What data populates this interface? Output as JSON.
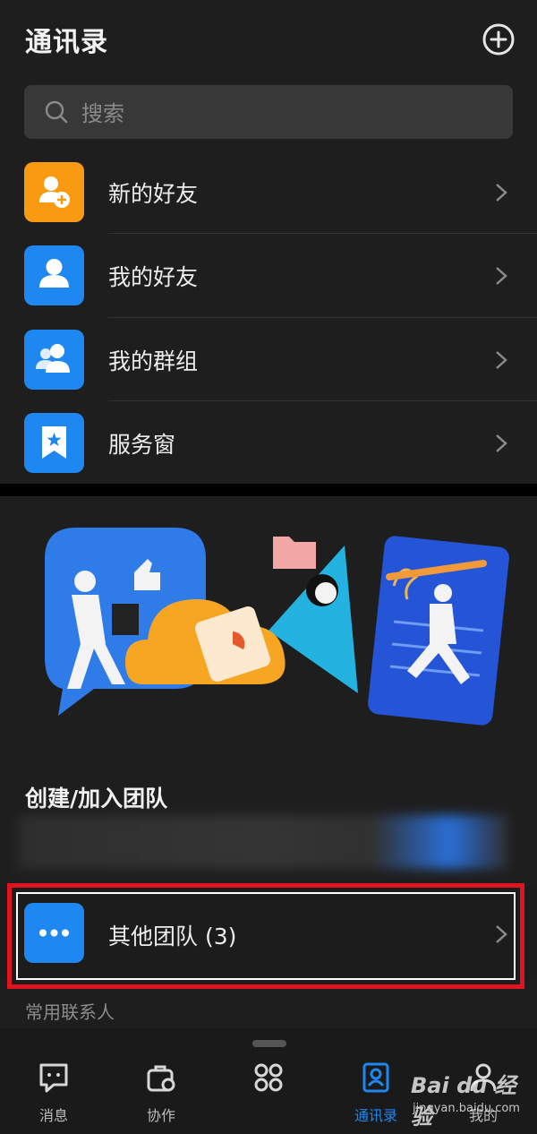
{
  "header": {
    "title": "通讯录"
  },
  "search": {
    "placeholder": "搜索"
  },
  "list": {
    "items": [
      {
        "label": "新的好友",
        "icon": "add-user-icon",
        "color": "#f99a13"
      },
      {
        "label": "我的好友",
        "icon": "user-icon",
        "color": "#1f87f0"
      },
      {
        "label": "我的群组",
        "icon": "group-icon",
        "color": "#1f87f0"
      },
      {
        "label": "服务窗",
        "icon": "bookmark-star-icon",
        "color": "#1f87f0"
      }
    ]
  },
  "team": {
    "title": "创建/加入团队",
    "other_label": "其他团队 (3)"
  },
  "contacts": {
    "label": "常用联系人"
  },
  "tabs": [
    {
      "label": "消息",
      "icon": "message-icon"
    },
    {
      "label": "协作",
      "icon": "collab-icon"
    },
    {
      "label": "",
      "icon": "apps-icon"
    },
    {
      "label": "通讯录",
      "icon": "contacts-icon",
      "active": true
    },
    {
      "label": "我的",
      "icon": "profile-icon"
    }
  ],
  "watermark": {
    "line1": "Bai du 经验",
    "line2": "jingyan.baidu.com"
  },
  "colors": {
    "accent": "#1f87f0",
    "orange": "#f99a13",
    "highlight": "#e0141e"
  }
}
